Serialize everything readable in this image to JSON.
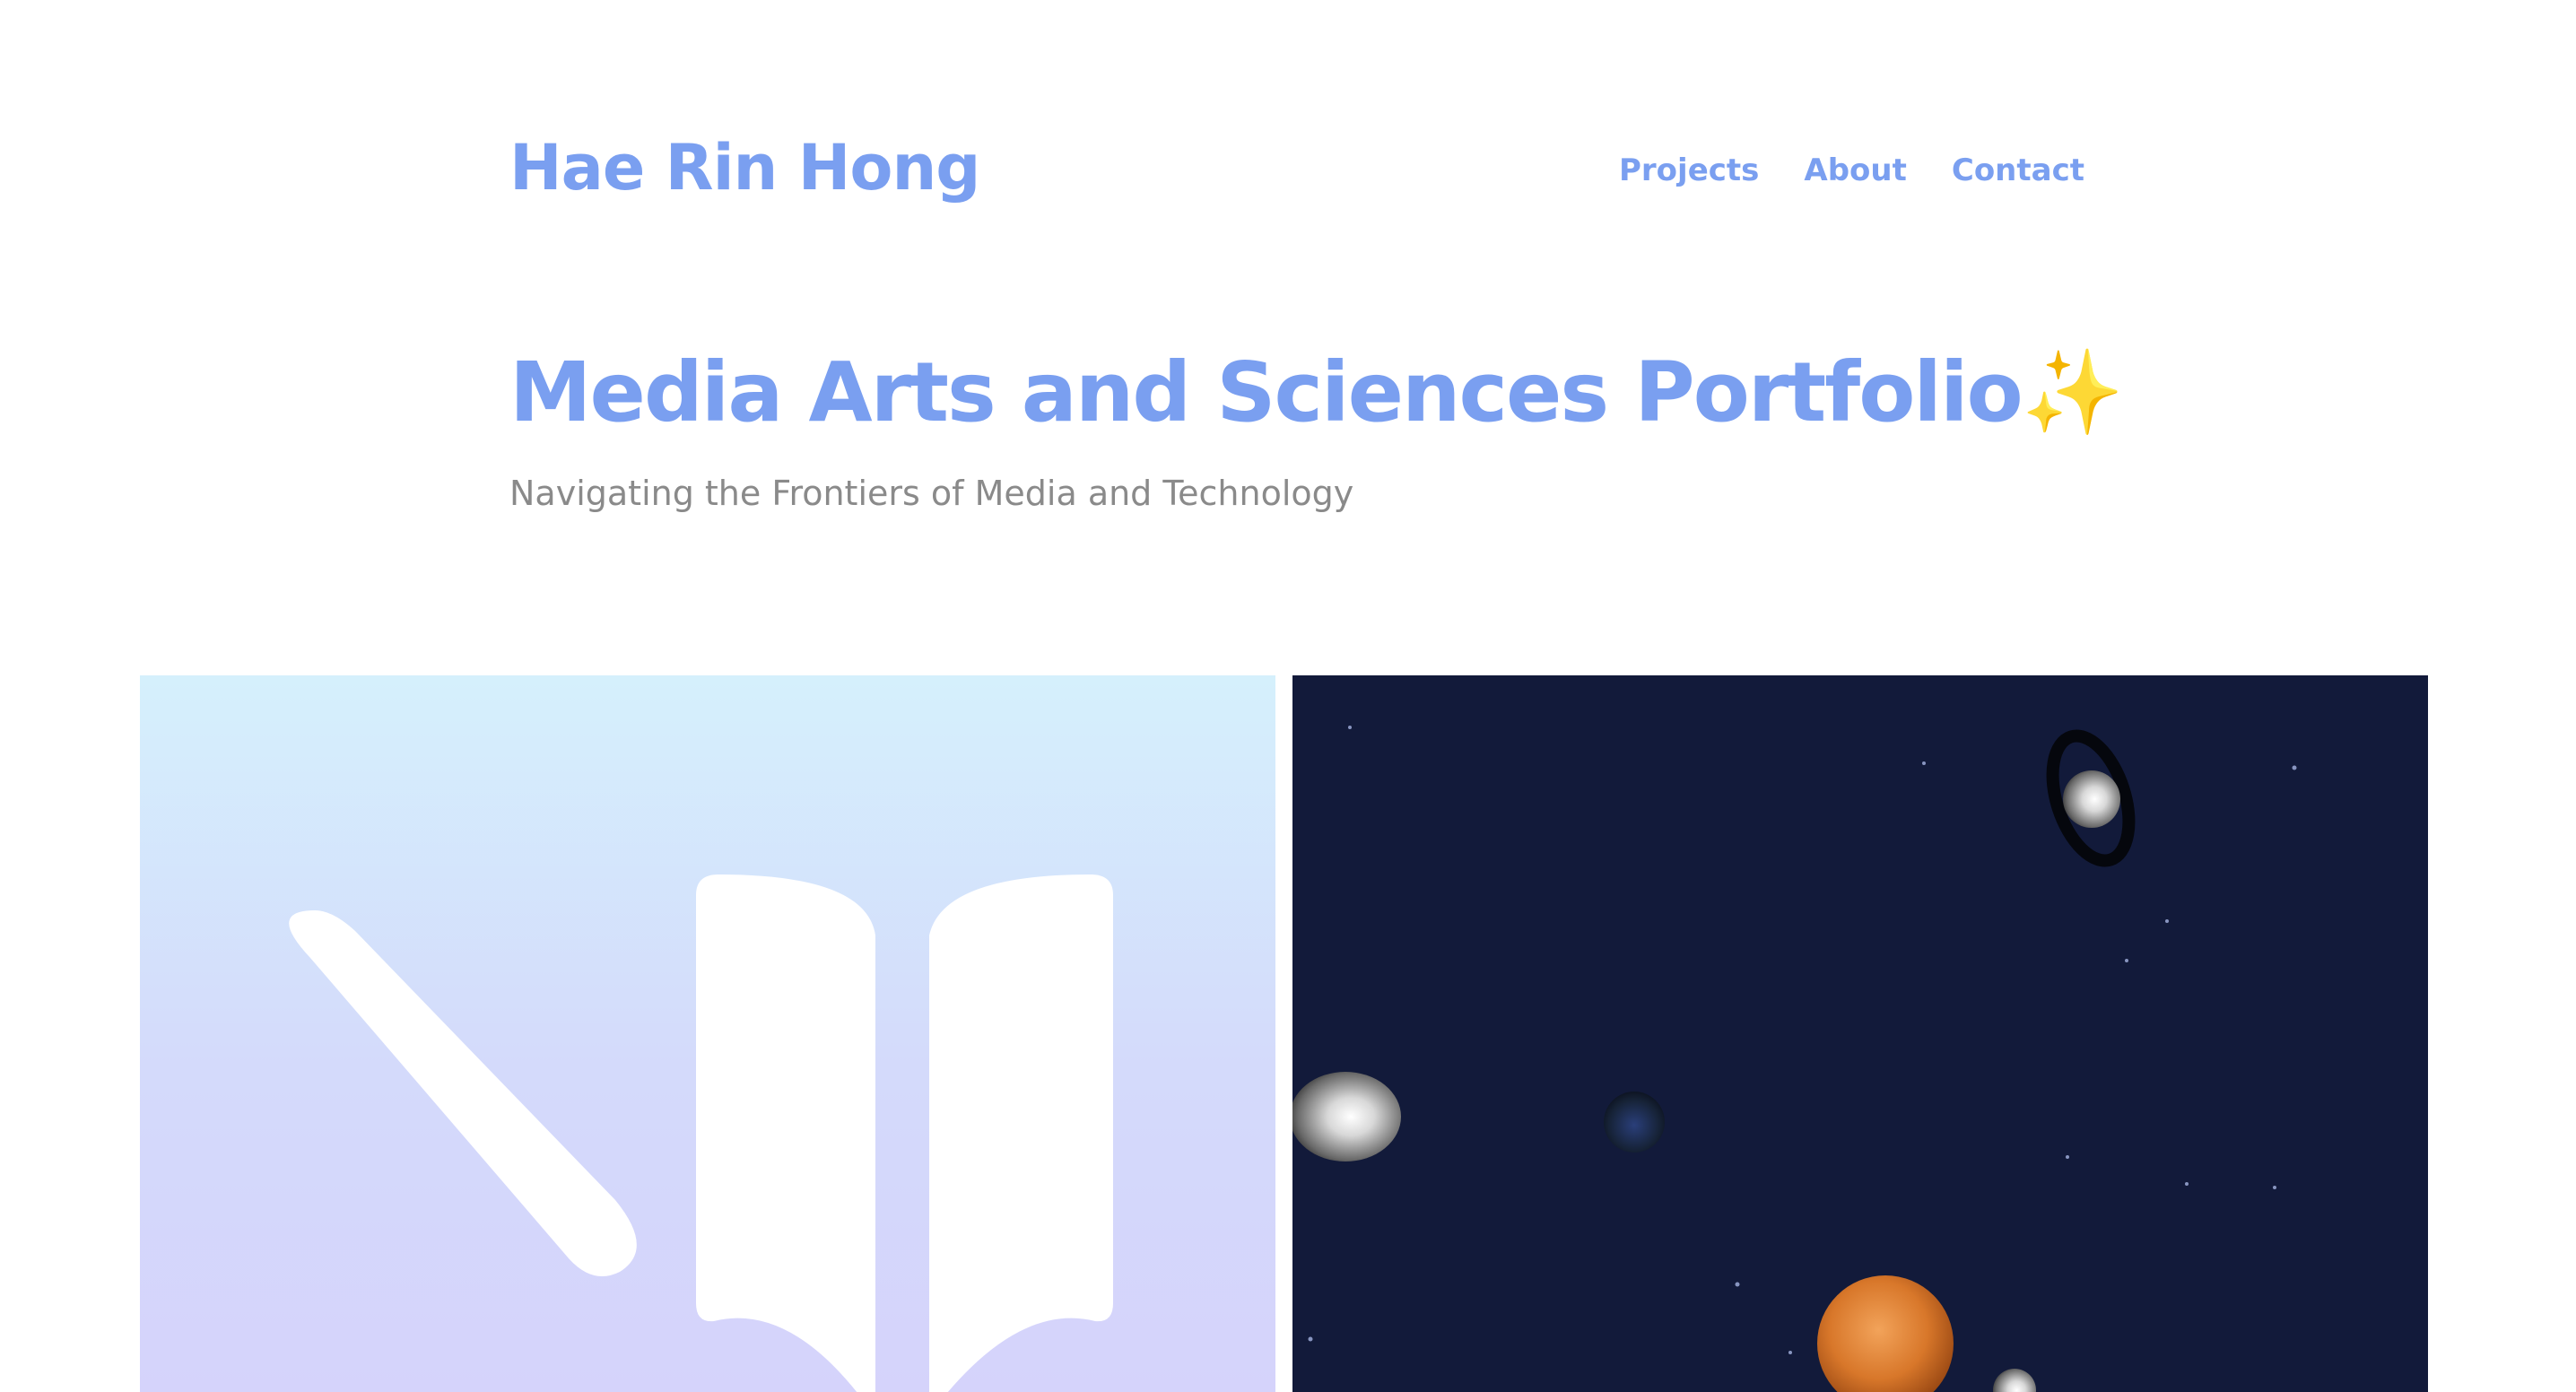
{
  "header": {
    "site_title": "Hae Rin Hong",
    "nav": [
      {
        "label": "Projects"
      },
      {
        "label": "About"
      },
      {
        "label": "Contact"
      }
    ]
  },
  "hero": {
    "title": "Media Arts and Sciences Portfolio",
    "sparkle": "✨",
    "subtitle": "Navigating the Frontiers of Media and Technology"
  },
  "projects": [
    {
      "thumbnail_icon": "pen-and-book-icon",
      "background": "#d5e6fb"
    },
    {
      "thumbnail_icon": "solar-system-illustration",
      "background": "#121a3a"
    }
  ],
  "colors": {
    "accent": "#7a9ff0",
    "subtitle": "#8a8a8a",
    "space_bg": "#121a3a",
    "sparkle": "#f4c430"
  }
}
